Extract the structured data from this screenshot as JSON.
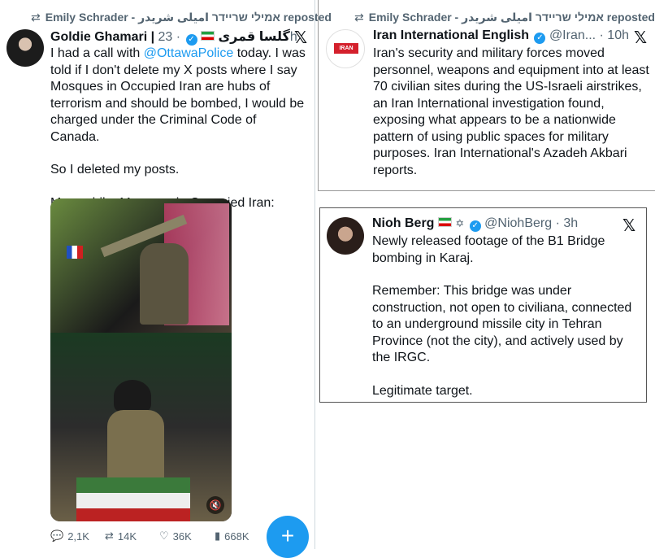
{
  "left_post": {
    "repost_user": "Emily Schrader - אמילי שריידר امیلی شریدر reposted",
    "repost_icon": "repost-icon",
    "author": "Goldie Ghamari | گلسا قمری",
    "time": "· 23h",
    "body_1_pre": "I had a call with ",
    "body_1_link": "@OttawaPolice",
    "body_1_post": " today. I was told if I don't delete my X posts where I say Mosques in Occupied Iran are hubs of terrorism and should be bombed, I would be charged under the Criminal Code of Canada.",
    "body_2": "So I deleted my posts.",
    "body_3": "Meanwhile, Mosques in Occupied Iran:",
    "stats": {
      "replies": "2,1K",
      "reposts": "14K",
      "likes": "36K",
      "views": "668K"
    },
    "compose_label": "+"
  },
  "top_right_post": {
    "repost_user": "Emily Schrader - אמילי שריידר امیلی شریدر reposted",
    "author": "Iran International English",
    "handle_time": "@Iran... · 10h",
    "avatar_text": "IRAN",
    "body": "Iran's security and military forces moved personnel, weapons and equipment into at least 70 civilian sites during the US-Israeli airstrikes, an Iran International investigation found, exposing what appears to be a nationwide pattern of using public spaces for military purposes. Iran International's Azadeh Akbari reports."
  },
  "bottom_right_post": {
    "author": "Nioh Berg",
    "author_symbols": "✡",
    "handle_time": "@NiohBerg · 3h",
    "body_1": "Newly released footage of the B1 Bridge bombing in Karaj.",
    "body_2": "Remember: This bridge was under construction, not open to civiliana, connected to an underground missile city in Tehran Province (not the city), and actively used by the IRGC.",
    "body_3": "Legitimate target."
  },
  "colors": {
    "link": "#1d9bf0",
    "verified": "#1d9bf0",
    "muted": "#536471",
    "iran_intl_red": "#d4202c"
  }
}
